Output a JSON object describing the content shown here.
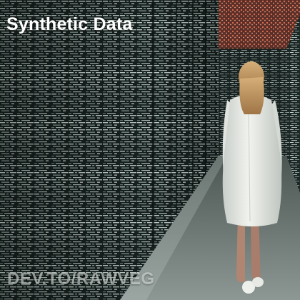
{
  "overlay": {
    "title": "Synthetic Data",
    "watermark": "DEV.TO/RAWVEG"
  },
  "colors": {
    "wall_dark": "#1b2422",
    "wall_light": "#cfe0dc",
    "ceiling_red": "#b4533e",
    "floor": "#7b8784",
    "dress": "#e9ece6",
    "hair": "#c9a06a",
    "title_text": "#ffffff"
  }
}
